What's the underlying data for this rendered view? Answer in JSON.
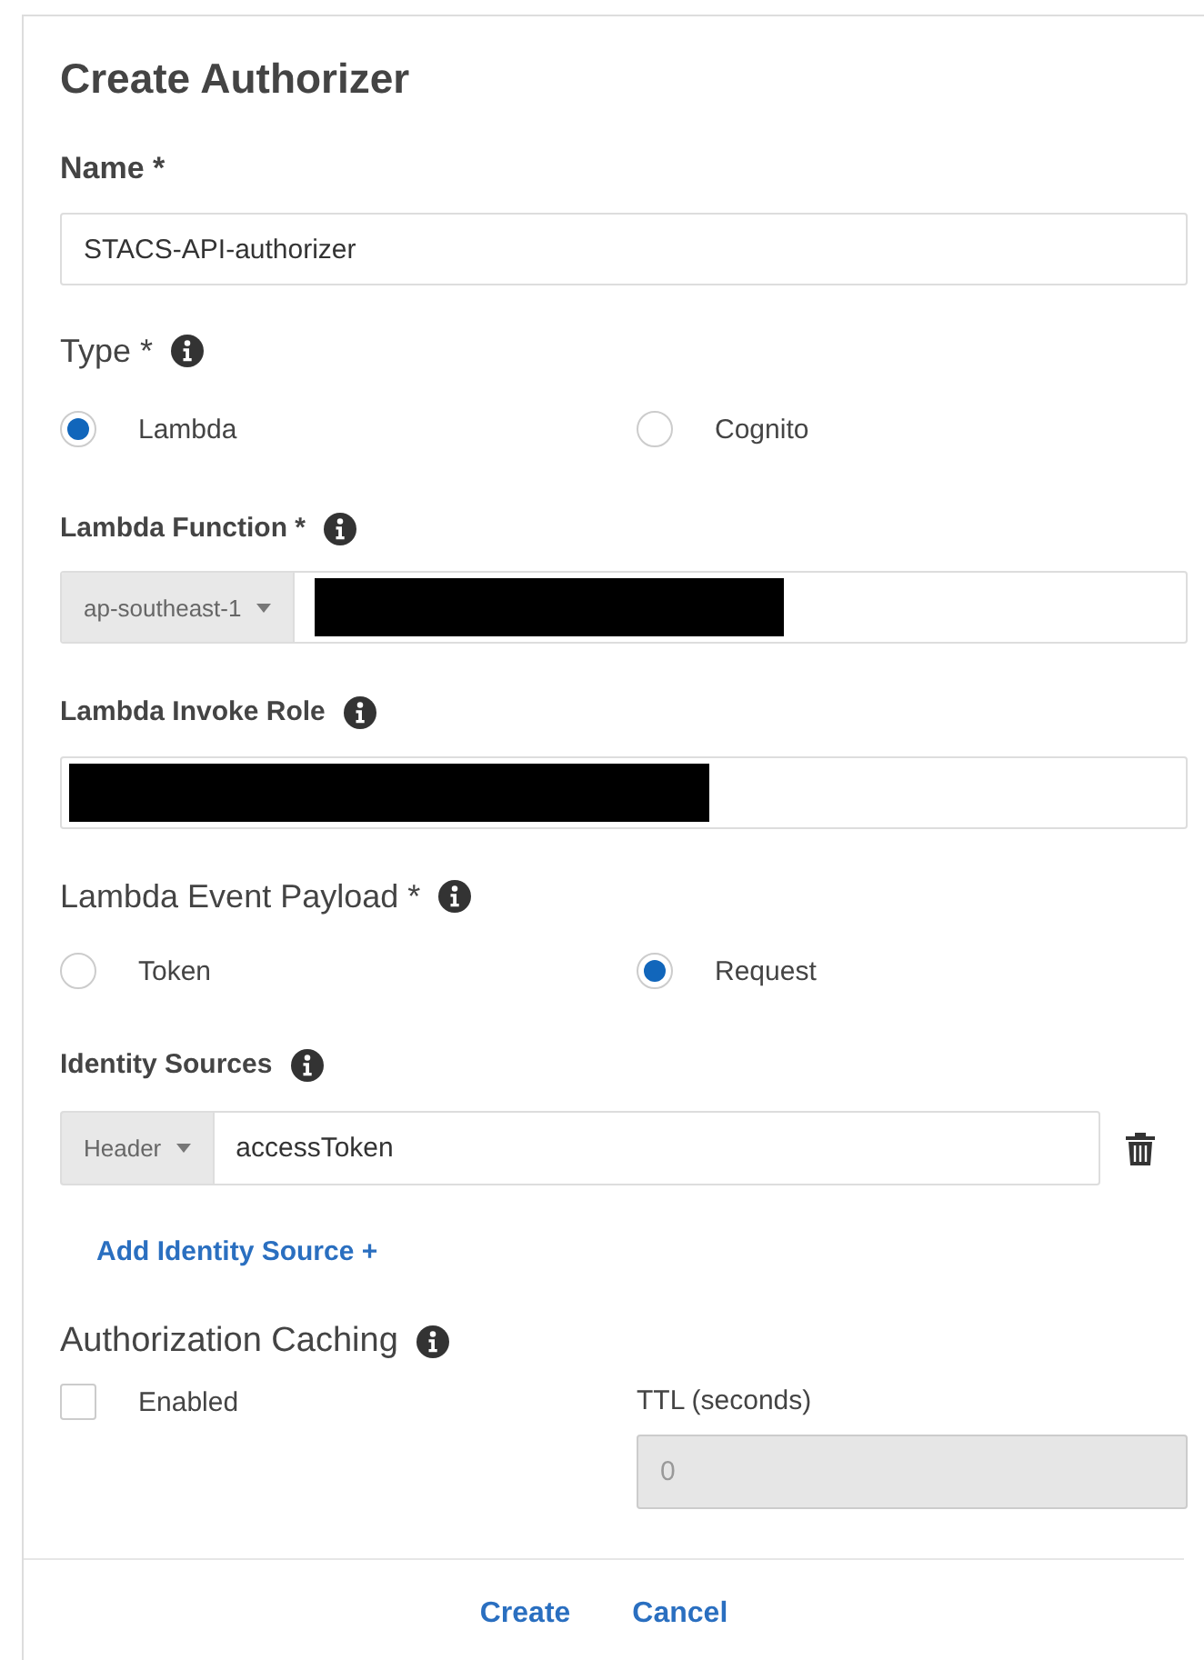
{
  "title": "Create Authorizer",
  "name_field": {
    "label": "Name *",
    "value": "STACS-API-authorizer"
  },
  "type": {
    "label": "Type *",
    "options": [
      {
        "label": "Lambda",
        "selected": true
      },
      {
        "label": "Cognito",
        "selected": false
      }
    ]
  },
  "lambda_function": {
    "label": "Lambda Function *",
    "region": "ap-southeast-1",
    "redacted": true
  },
  "invoke_role": {
    "label": "Lambda Invoke Role",
    "redacted": true
  },
  "event_payload": {
    "label": "Lambda Event Payload *",
    "options": [
      {
        "label": "Token",
        "selected": false
      },
      {
        "label": "Request",
        "selected": true
      }
    ]
  },
  "identity_sources": {
    "label": "Identity Sources",
    "rows": [
      {
        "type": "Header",
        "value": "accessToken"
      }
    ],
    "add_link": "Add Identity Source +"
  },
  "caching": {
    "label": "Authorization Caching",
    "enabled_label": "Enabled",
    "checked": false,
    "ttl_label": "TTL (seconds)",
    "ttl_value": "0",
    "ttl_disabled": true
  },
  "buttons": [
    {
      "label": "Create"
    },
    {
      "label": "Cancel"
    }
  ]
}
